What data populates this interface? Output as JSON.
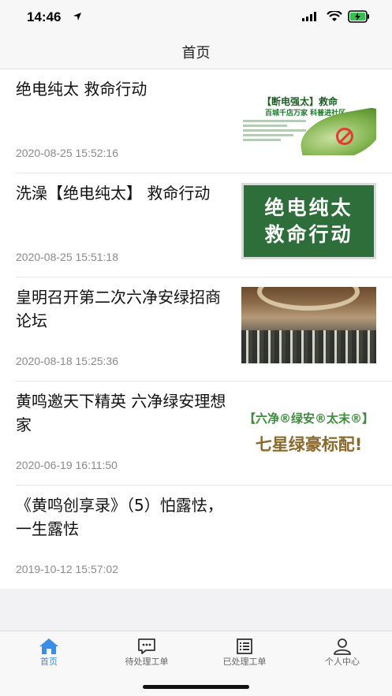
{
  "status_bar": {
    "time": "14:46"
  },
  "nav": {
    "title": "首页"
  },
  "articles": [
    {
      "title": "绝电纯太 救命行动",
      "time": "2020-08-25 15:52:16"
    },
    {
      "title": "洗澡【绝电纯太】 救命行动",
      "time": "2020-08-25 15:51:18"
    },
    {
      "title": "皇明召开第二次六净安绿招商论坛",
      "time": "2020-08-18 15:25:36"
    },
    {
      "title": "黄鸣邀天下精英 六净绿安理想家",
      "time": "2020-06-19 16:11:50"
    },
    {
      "title": "《黄鸣创享录》（5）怕露怯，一生露怯",
      "time": "2019-10-12 15:57:02"
    }
  ],
  "thumbnails": {
    "t1_big": "断电强太",
    "t1_tail": "救命",
    "t1_sub": "百城千店万家 科普进社区",
    "t2_line1": "绝电纯太",
    "t2_line2": "救命行动",
    "t4_top": "【六净®绿安®太末®】",
    "t4_bottom": "七星绿豪标配!"
  },
  "tabs": [
    {
      "label": "首页",
      "icon": "home-icon",
      "active": true
    },
    {
      "label": "待处理工单",
      "icon": "chat-icon",
      "active": false
    },
    {
      "label": "已处理工单",
      "icon": "list-icon",
      "active": false
    },
    {
      "label": "个人中心",
      "icon": "user-icon",
      "active": false
    }
  ],
  "colors": {
    "accent": "#3a8ee6",
    "text_primary": "#111111",
    "text_secondary": "#8a8a8a"
  }
}
